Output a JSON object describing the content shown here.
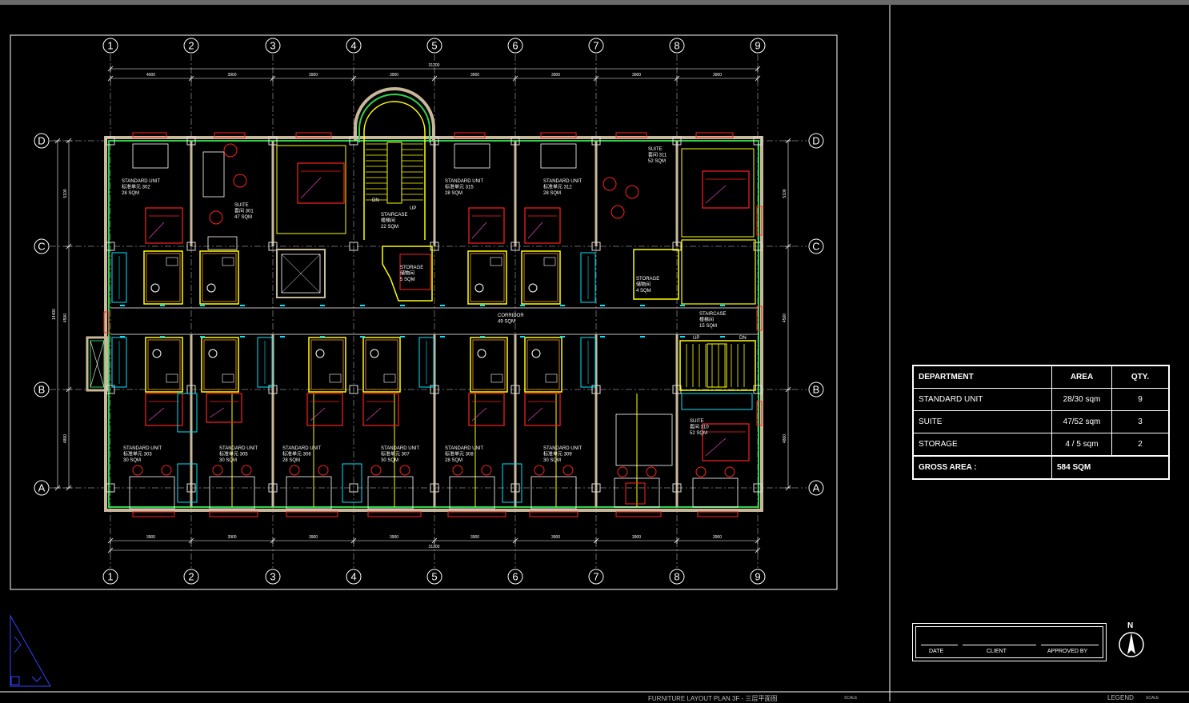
{
  "grid": {
    "columns": [
      "1",
      "2",
      "3",
      "4",
      "5",
      "6",
      "7",
      "8",
      "9"
    ],
    "rows": [
      "D",
      "C",
      "B",
      "A"
    ]
  },
  "dimensions": {
    "overall_top": "31200",
    "overall_bottom": "31200",
    "top_segments": [
      "4000",
      "3900",
      "3900",
      "3900",
      "3900",
      "3900",
      "3900",
      "3900"
    ],
    "bottom_segments": [
      "3900",
      "3900",
      "3900",
      "3900",
      "3900",
      "3900",
      "3900",
      "3900"
    ],
    "left_segments": [
      "5100",
      "4500",
      "4800"
    ],
    "left_overall": "14400",
    "right_segments": [
      "5100",
      "4500",
      "4800"
    ]
  },
  "rooms": [
    {
      "lines": [
        "STANDARD UNIT",
        "标准单元 302",
        "28 SQM"
      ]
    },
    {
      "lines": [
        "SUITE",
        "套间 301",
        "47 SQM"
      ]
    },
    {
      "lines": [
        "STAIRCASE",
        "楼梯间",
        "22 SQM"
      ]
    },
    {
      "lines": [
        "STANDARD UNIT",
        "标准单元 315",
        "28 SQM"
      ]
    },
    {
      "lines": [
        "STANDARD UNIT",
        "标准单元 312",
        "28 SQM"
      ]
    },
    {
      "lines": [
        "SUITE",
        "套间 311",
        "52 SQM"
      ]
    },
    {
      "lines": [
        "STORAGE",
        "储物间",
        "5 SQM"
      ]
    },
    {
      "lines": [
        "STORAGE",
        "储物间",
        "4 SQM"
      ]
    },
    {
      "lines": [
        "CORRIDOR",
        "49 SQM"
      ]
    },
    {
      "lines": [
        "STAIRCASE",
        "楼梯间",
        "15 SQM"
      ]
    },
    {
      "lines": [
        "STANDARD UNIT",
        "标准单元 303",
        "30 SQM"
      ]
    },
    {
      "lines": [
        "STANDARD UNIT",
        "标准单元 305",
        "30 SQM"
      ]
    },
    {
      "lines": [
        "STANDARD UNIT",
        "标准单元 306",
        "28 SQM"
      ]
    },
    {
      "lines": [
        "STANDARD UNIT",
        "标准单元 307",
        "30 SQM"
      ]
    },
    {
      "lines": [
        "STANDARD UNIT",
        "标准单元 308",
        "28 SQM"
      ]
    },
    {
      "lines": [
        "STANDARD UNIT",
        "标准单元 309",
        "30 SQM"
      ]
    },
    {
      "lines": [
        "SUITE",
        "套间 310",
        "52 SQM"
      ]
    }
  ],
  "stair_marks": {
    "dn": "DN",
    "up": "UP"
  },
  "legend": {
    "headers": {
      "department": "DEPARTMENT",
      "area": "AREA",
      "qty": "QTY."
    },
    "rows": [
      {
        "department": "STANDARD UNIT",
        "area": "28/30 sqm",
        "qty": "9"
      },
      {
        "department": "SUITE",
        "area": "47/52 sqm",
        "qty": "3"
      },
      {
        "department": "STORAGE",
        "area": "4 / 5 sqm",
        "qty": "2"
      }
    ],
    "gross_label": "GROSS AREA :",
    "gross_value": "584 SQM"
  },
  "title_block": {
    "date": "DATE",
    "client": "CLIENT",
    "approved": "APPROVED BY"
  },
  "north": "N",
  "bottom_strip": {
    "drawing_title": "FURNITURE LAYOUT PLAN 3F - 三层平面图",
    "scale_label_1": "SCALE",
    "scale_label_2": "SCALE",
    "legend_label": "LEGEND"
  },
  "colors": {
    "wall_green": "#2fd24a",
    "wall_tan": "#c8b89a",
    "yellow": "#ffff00",
    "red": "#ff2020",
    "cyan": "#00e5ff",
    "magenta": "#ff4bd8",
    "orange": "#ff9a2e",
    "blue_ucs": "#3344ff"
  }
}
